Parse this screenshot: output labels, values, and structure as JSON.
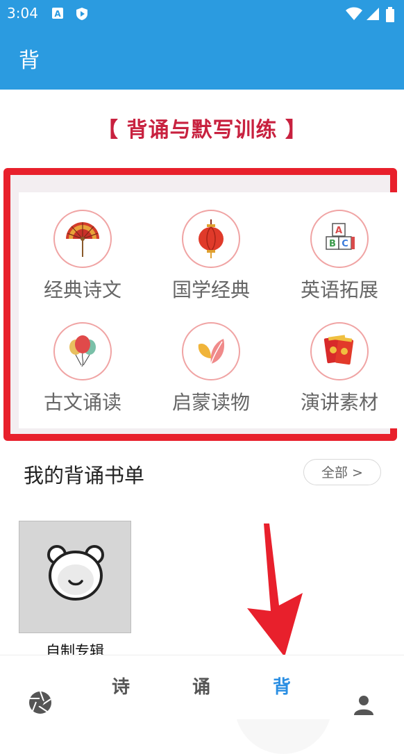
{
  "status_bar": {
    "time": "3:04",
    "left_icons": [
      "notification-a-icon",
      "play-shield-icon"
    ],
    "right_icons": [
      "wifi-icon",
      "signal-icon",
      "battery-icon"
    ]
  },
  "app_bar": {
    "title": "背"
  },
  "headline": "【 背诵与默写训练 】",
  "categories": [
    {
      "label": "经典诗文",
      "icon": "fan-icon"
    },
    {
      "label": "国学经典",
      "icon": "lantern-icon"
    },
    {
      "label": "英语拓展",
      "icon": "abc-blocks-icon"
    },
    {
      "label": "古文诵读",
      "icon": "balloons-icon"
    },
    {
      "label": "启蒙读物",
      "icon": "leaf-icon"
    },
    {
      "label": "演讲素材",
      "icon": "red-envelope-icon"
    }
  ],
  "booklist": {
    "title": "我的背诵书单",
    "all_button": "全部 >",
    "albums": [
      {
        "label": "自制专辑",
        "icon": "bear-face-icon"
      }
    ]
  },
  "bottom_nav": {
    "active_index": 3,
    "active_color": "#2b8fe3",
    "tabs": [
      {
        "label": "",
        "icon": "aperture-icon"
      },
      {
        "label": "诗"
      },
      {
        "label": "诵"
      },
      {
        "label": "背"
      },
      {
        "label": "",
        "icon": "person-icon"
      }
    ]
  },
  "colors": {
    "primary": "#2b9be0",
    "headline": "#c8213f",
    "highlight_border": "#e8202c"
  }
}
